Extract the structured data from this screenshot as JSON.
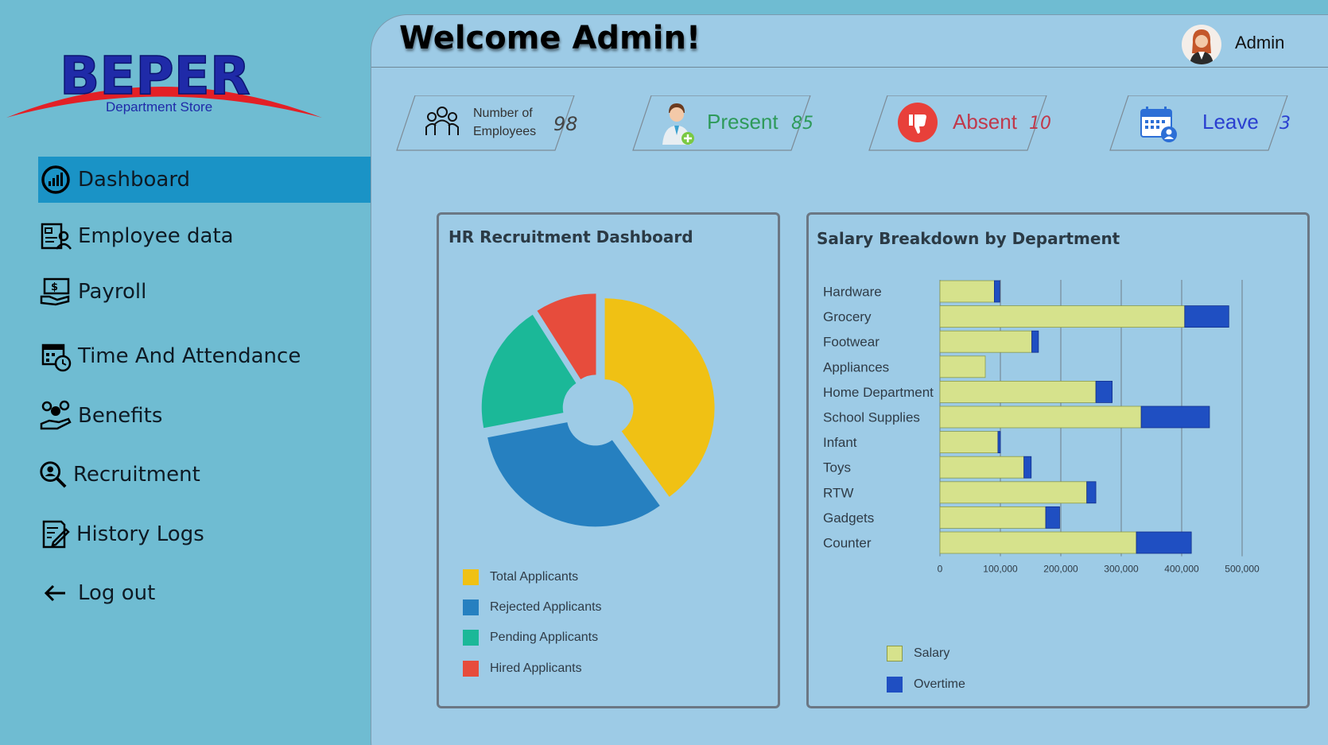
{
  "brand": {
    "name": "BEPER",
    "subtitle": "Department Store"
  },
  "sidebar": {
    "items": [
      {
        "label": "Dashboard",
        "icon": "dashboard-gauge-icon",
        "active": true
      },
      {
        "label": "Employee data",
        "icon": "employee-data-icon"
      },
      {
        "label": "Payroll",
        "icon": "payroll-money-icon"
      },
      {
        "label": "Time And Attendance",
        "icon": "calendar-clock-icon"
      },
      {
        "label": "Benefits",
        "icon": "benefits-hand-icon"
      },
      {
        "label": "Recruitment",
        "icon": "recruitment-search-icon"
      },
      {
        "label": "History Logs",
        "icon": "history-logs-icon"
      },
      {
        "label": "Log out",
        "icon": "arrow-left-icon"
      }
    ],
    "active_color": "#1a93c6"
  },
  "header": {
    "welcome": "Welcome Admin!",
    "user": "Admin"
  },
  "stats": {
    "employees": {
      "label_line1": "Number of",
      "label_line2": "Employees",
      "value": "98"
    },
    "present": {
      "label": "Present",
      "value": "85",
      "color": "#2e9a5a"
    },
    "absent": {
      "label": "Absent",
      "value": "10",
      "color": "#c0394b"
    },
    "leave": {
      "label": "Leave",
      "value": "3",
      "color": "#2a3fd0"
    }
  },
  "recruitment": {
    "title": "HR Recruitment Dashboard",
    "legend": {
      "total": "Total Applicants",
      "rejected": "Rejected Applicants",
      "pending": "Pending Applicants",
      "hired": "Hired Applicants"
    }
  },
  "salary": {
    "title": "Salary Breakdown by Department",
    "legend": {
      "salary": "Salary",
      "overtime": "Overtime"
    }
  },
  "chart_data": [
    {
      "type": "pie",
      "title": "HR Recruitment Dashboard",
      "series": [
        {
          "name": "Total Applicants",
          "value": 40,
          "color": "#f0c114"
        },
        {
          "name": "Rejected Applicants",
          "value": 32,
          "color": "#2680c0"
        },
        {
          "name": "Pending Applicants",
          "value": 19,
          "color": "#1bb898"
        },
        {
          "name": "Hired Applicants",
          "value": 9,
          "color": "#e74c3c"
        }
      ],
      "donut": true,
      "legend_position": "bottom"
    },
    {
      "type": "bar",
      "orientation": "horizontal",
      "stacked": true,
      "title": "Salary Breakdown by Department",
      "categories": [
        "Hardware",
        "Grocery",
        "Footwear",
        "Appliances",
        "Home Department",
        "School Supplies",
        "Infant",
        "Toys",
        "RTW",
        "Gadgets",
        "Counter"
      ],
      "series": [
        {
          "name": "Salary",
          "color": "#d6e28c",
          "values": [
            90000,
            405000,
            152000,
            75000,
            258000,
            333000,
            96000,
            139000,
            243000,
            175000,
            325000
          ]
        },
        {
          "name": "Overtime",
          "color": "#1f4fc2",
          "values": [
            9000,
            73000,
            11000,
            0,
            27000,
            113000,
            4000,
            12000,
            15000,
            23000,
            91000
          ]
        }
      ],
      "xlim": [
        0,
        500000
      ],
      "xticks": [
        "0",
        "100,000",
        "200,000",
        "300,000",
        "400,000",
        "500,000"
      ],
      "grid": true,
      "legend_position": "bottom-left"
    }
  ]
}
